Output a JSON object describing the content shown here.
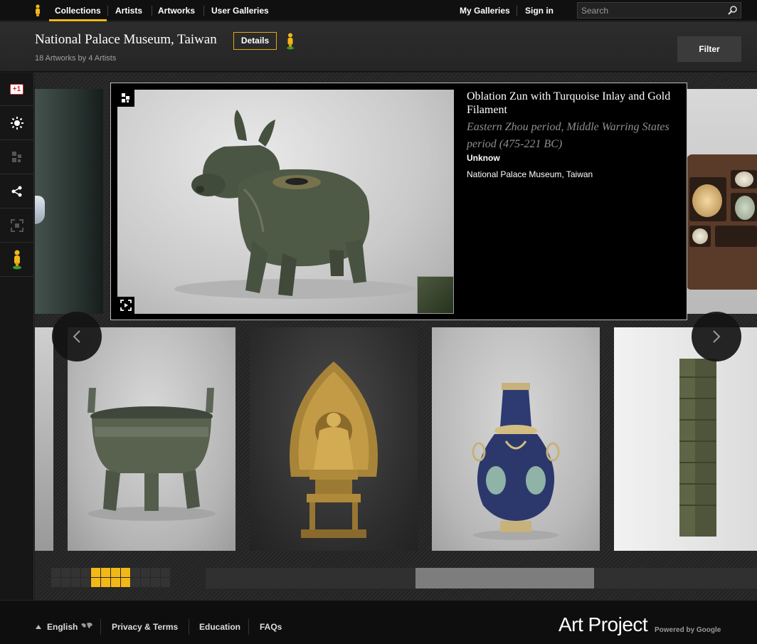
{
  "nav": {
    "tabs": [
      {
        "label": "Collections",
        "active": true
      },
      {
        "label": "Artists",
        "active": false
      },
      {
        "label": "Artworks",
        "active": false
      },
      {
        "label": "User Galleries",
        "active": false
      }
    ],
    "my_galleries": "My Galleries",
    "sign_in": "Sign in",
    "search_placeholder": "Search"
  },
  "header": {
    "title": "National Palace Museum, Taiwan",
    "subtitle": "18 Artworks by 4 Artists",
    "details_label": "Details",
    "filter_label": "Filter"
  },
  "tools": [
    {
      "icon": "google-plus-one-icon",
      "label": "+1"
    },
    {
      "icon": "brightness-icon"
    },
    {
      "icon": "qr-code-icon"
    },
    {
      "icon": "share-icon"
    },
    {
      "icon": "fullscreen-icon"
    },
    {
      "icon": "pegman-icon"
    }
  ],
  "artwork": {
    "title": "Oblation Zun with Turquoise Inlay and Gold Filament",
    "date": "Eastern Zhou period, Middle Warring States period (475-221 BC)",
    "artist": "Unknow",
    "owner": "National Palace Museum, Taiwan"
  },
  "pager": {
    "scroll_position": 0.38
  },
  "footer": {
    "language": "English",
    "links": [
      "Privacy & Terms",
      "Education",
      "FAQs"
    ],
    "brand": "Art Project",
    "powered": "Powered by Google"
  },
  "colors": {
    "accent": "#f2b817",
    "background": "#1c1c1c",
    "popup_bg": "#000000"
  }
}
